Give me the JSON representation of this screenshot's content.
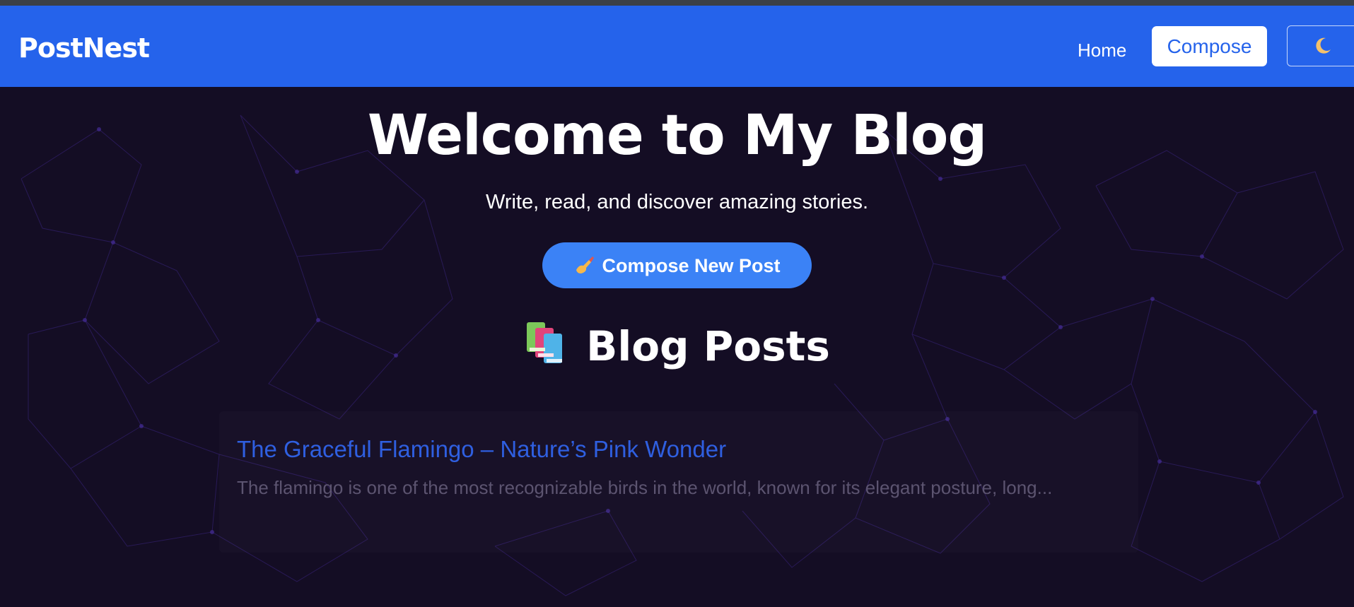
{
  "colors": {
    "navbar": "#2563eb",
    "background": "#140d24",
    "accent_button": "#3b82f6",
    "post_title": "#2f5fe0",
    "excerpt": "#5c5470"
  },
  "navbar": {
    "brand": "PostNest",
    "home_label": "Home",
    "compose_label": "Compose",
    "theme_toggle_icon": "moon-icon"
  },
  "hero": {
    "title": "Welcome to My Blog",
    "subtitle": "Write, read, and discover amazing stories.",
    "cta_icon": "writing-hand-icon",
    "cta_label": "Compose New Post"
  },
  "posts_section": {
    "icon": "books-icon",
    "title": "Blog Posts",
    "posts": [
      {
        "title": "The Graceful Flamingo – Nature’s Pink Wonder",
        "excerpt": "The flamingo is one of the most recognizable birds in the world, known for its elegant posture, long..."
      }
    ]
  }
}
